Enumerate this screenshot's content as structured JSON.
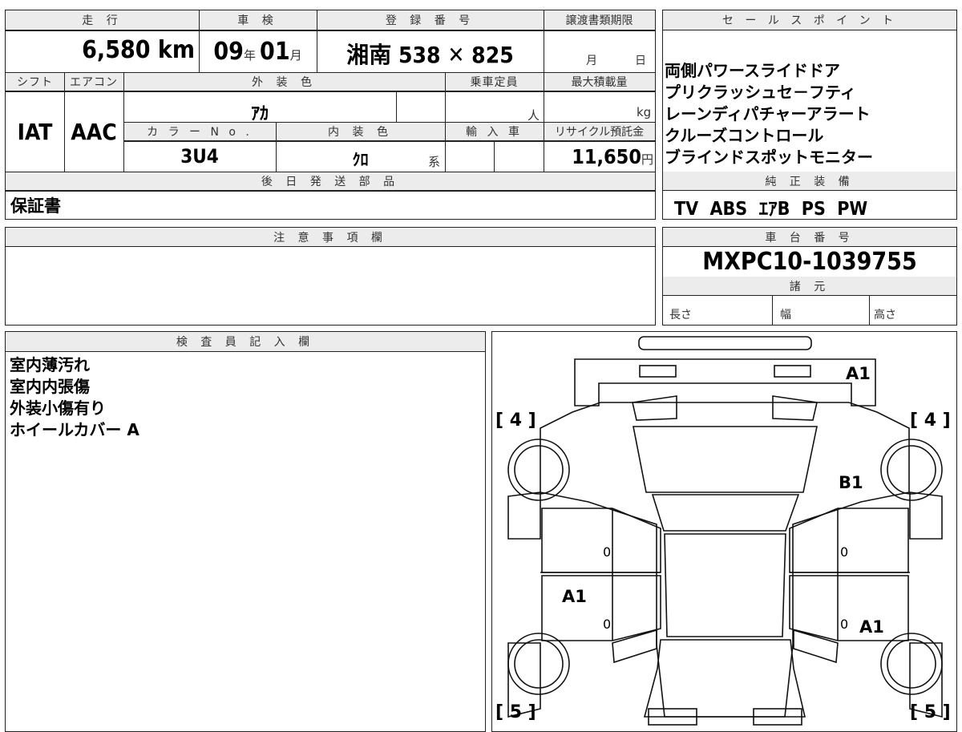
{
  "top": {
    "mileage_label": "走 行",
    "mileage_value": "6,580 km",
    "inspection_label": "車 検",
    "inspection_year": "09",
    "inspection_year_unit": "年",
    "inspection_month": "01",
    "inspection_month_unit": "月",
    "registration_label": "登 録 番 号",
    "registration_value": "湘南 538 ✕ 825",
    "transfer_deadline_label": "譲渡書類期限",
    "transfer_month_unit": "月",
    "transfer_day_unit": "日",
    "shift_label": "シフト",
    "shift_value": "IAT",
    "ac_label": "エアコン",
    "ac_value": "AAC",
    "exterior_color_label": "外 装 色",
    "exterior_color_value": "ｱｶ",
    "capacity_label": "乗車定員",
    "capacity_unit": "人",
    "max_load_label": "最大積載量",
    "max_load_unit": "kg",
    "color_no_label": "カ ラ ー N o .",
    "color_no_value": "3U4",
    "interior_color_label": "内 装 色",
    "interior_color_value": "ｸﾛ",
    "interior_color_suffix": "系",
    "import_label": "輸 入 車",
    "recycle_label": "リサイクル預託金",
    "recycle_value": "11,650",
    "recycle_unit": "円",
    "later_parts_label": "後 日 発 送 部 品",
    "later_parts_value": "保証書"
  },
  "sales_points": {
    "label": "セ ー ル ス ポ イ ン ト",
    "items": [
      "両側パワースライドドア",
      "プリクラッシュセ－フティ",
      "レーンディパチャーアラート",
      "クルーズコントロール",
      "ブラインドスポットモニター"
    ]
  },
  "standard_equipment": {
    "label": "純 正 装 備",
    "value": "TV  ABS  ｴｱB  PS  PW"
  },
  "notes": {
    "label": "注 意 事 項 欄"
  },
  "chassis": {
    "label": "車 台 番 号",
    "value": "MXPC10-1039755"
  },
  "specs": {
    "label": "諸 元",
    "length": "長さ",
    "width": "幅",
    "height": "高さ"
  },
  "inspector": {
    "label": "検 査 員 記 入 欄",
    "lines": [
      "室内薄汚れ",
      "室内内張傷",
      "外装小傷有り",
      "ホイールカバー A"
    ]
  },
  "diagram": {
    "marks": {
      "rear_right": "A1",
      "right_rear_door": "B1",
      "left_side": "A1",
      "right_side": "A1"
    },
    "tire_front_left": "[ 4 ]",
    "tire_front_right": "[ 4 ]",
    "tire_rear_left": "[ 5 ]",
    "tire_rear_right": "[ 5 ]",
    "zero": "0"
  }
}
